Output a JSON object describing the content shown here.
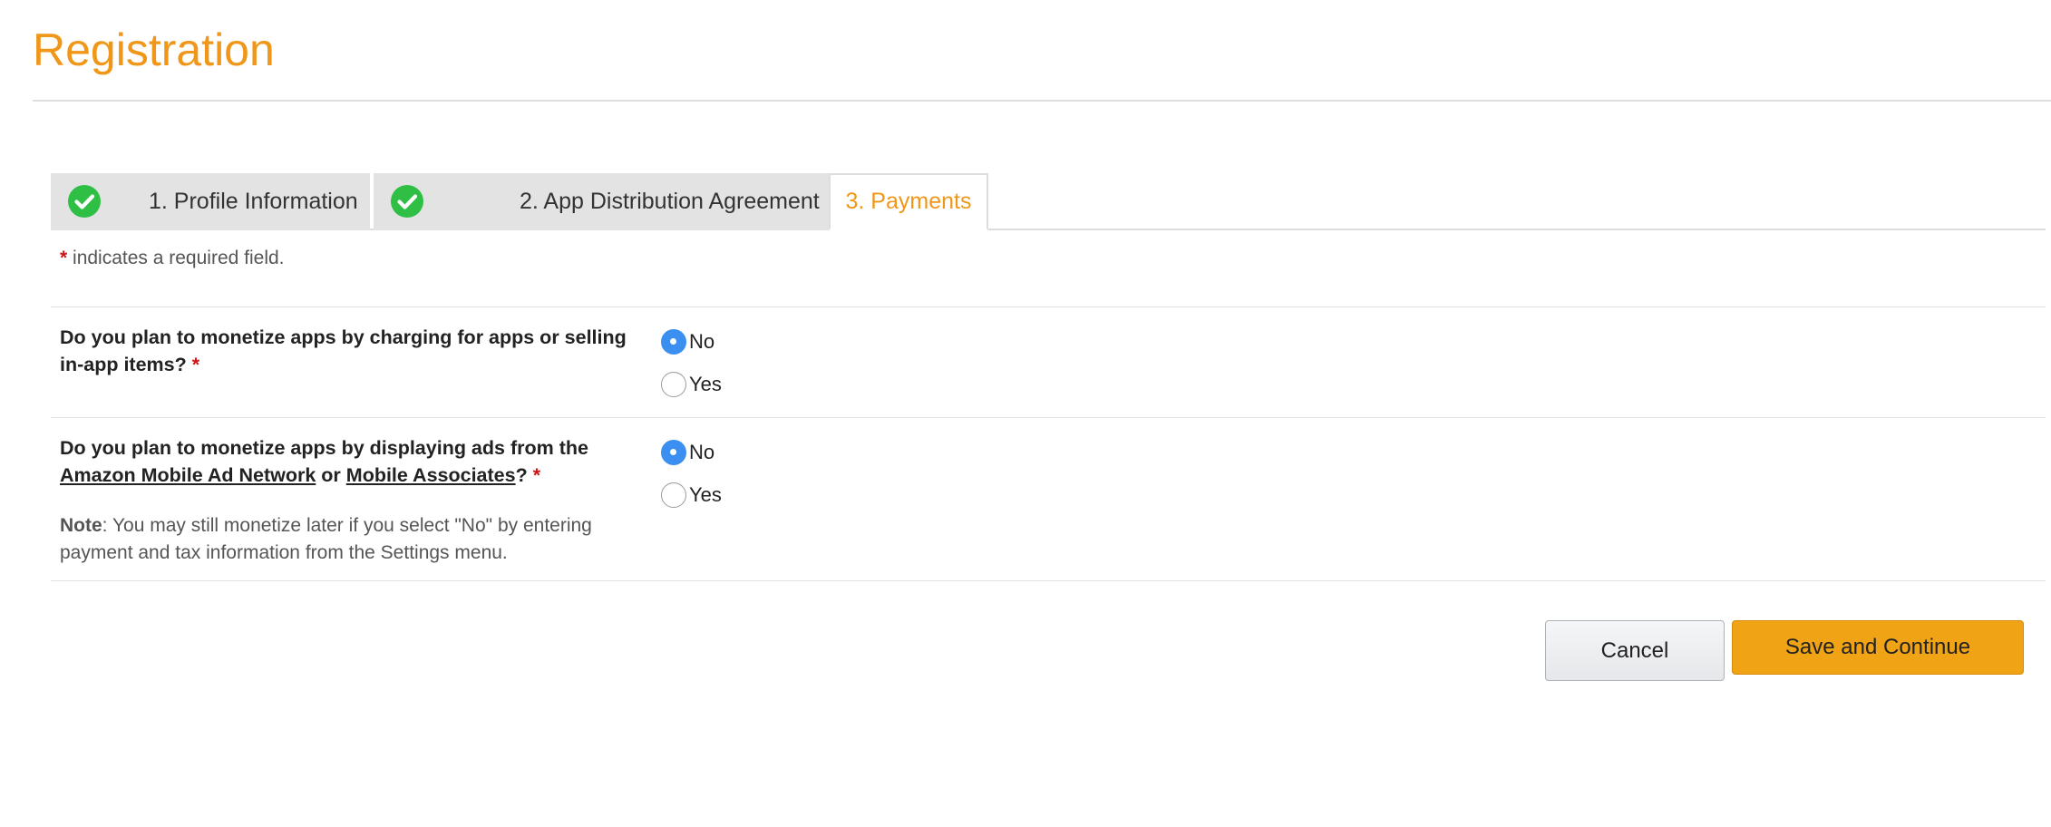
{
  "page": {
    "title": "Registration"
  },
  "tabs": [
    {
      "label": "1. Profile Information",
      "completed": true,
      "icon": "check-circle-icon"
    },
    {
      "label": "2. App Distribution Agreement",
      "completed": true,
      "icon": "check-circle-icon"
    },
    {
      "label": "3. Payments",
      "active": true
    }
  ],
  "form": {
    "required_star": "*",
    "required_note": "indicates a required field.",
    "q1": {
      "text": "Do you plan to monetize apps by charging for apps or selling in-app items?",
      "star": "*",
      "options": [
        {
          "label": "No",
          "selected": true
        },
        {
          "label": "Yes",
          "selected": false
        }
      ]
    },
    "q2": {
      "text_before": "Do you plan to monetize apps by displaying ads from the",
      "link1": "Amazon Mobile Ad Network",
      "text_or": "or",
      "link2": "Mobile Associates",
      "text_after": "?",
      "star": "*",
      "note_label": "Note",
      "note_text": ": You may still monetize later if you select \"No\" by entering payment and tax information from the Settings menu.",
      "options": [
        {
          "label": "No",
          "selected": true
        },
        {
          "label": "Yes",
          "selected": false
        }
      ]
    }
  },
  "buttons": {
    "cancel": "Cancel",
    "save": "Save and Continue"
  },
  "colors": {
    "accent": "#f0971a",
    "check_green": "#2fbf45",
    "radio_selected": "#3b8ff0",
    "required_star": "#d01414",
    "save_button": "#f0a314"
  }
}
